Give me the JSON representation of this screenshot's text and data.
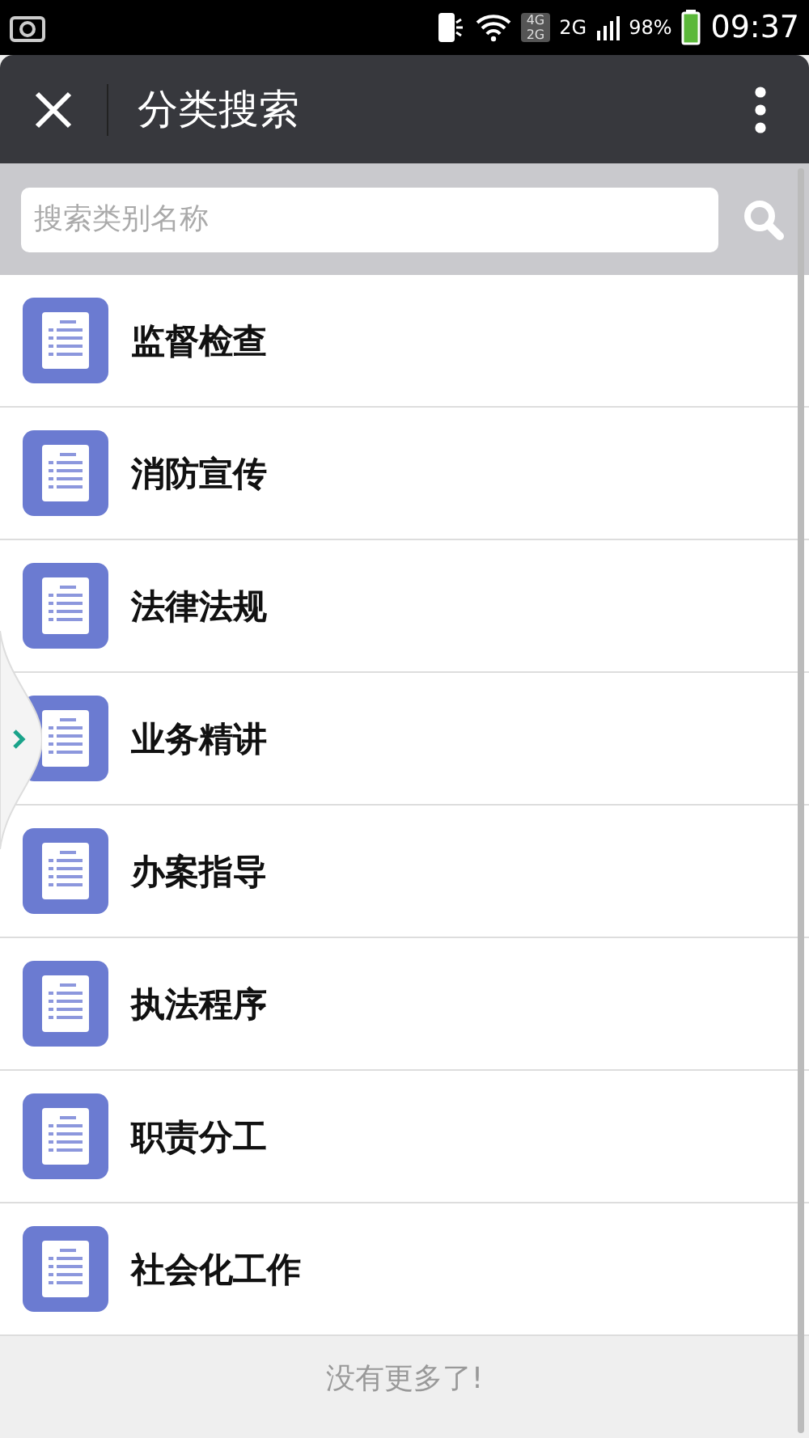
{
  "status_bar": {
    "network_badge": [
      "4G",
      "2G"
    ],
    "network_label": "2G",
    "battery": "98%",
    "time": "09:37"
  },
  "header": {
    "title": "分类搜索"
  },
  "search": {
    "placeholder": "搜索类别名称"
  },
  "categories": [
    {
      "label": "监督检查"
    },
    {
      "label": "消防宣传"
    },
    {
      "label": "法律法规"
    },
    {
      "label": "业务精讲"
    },
    {
      "label": "办案指导"
    },
    {
      "label": "执法程序"
    },
    {
      "label": "职责分工"
    },
    {
      "label": "社会化工作"
    }
  ],
  "footer": {
    "text": "没有更多了!"
  }
}
